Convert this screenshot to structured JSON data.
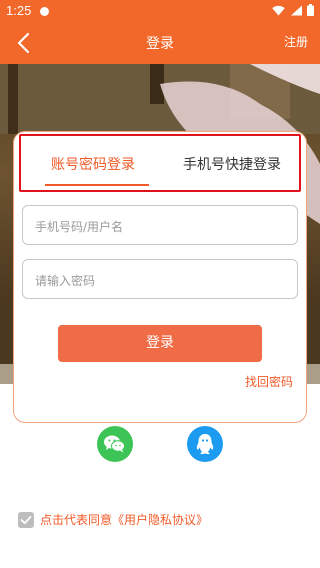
{
  "status_bar": {
    "time": "1:25"
  },
  "app_bar": {
    "title": "登录",
    "register": "注册"
  },
  "tabs": [
    {
      "label": "账号密码登录",
      "active": true
    },
    {
      "label": "手机号快捷登录",
      "active": false
    }
  ],
  "form": {
    "username_placeholder": "手机号码/用户名",
    "password_placeholder": "请输入密码",
    "login_button": "登录",
    "forgot_password": "找回密码"
  },
  "social": {
    "wechat_icon": "wechat-icon",
    "qq_icon": "qq-icon"
  },
  "agreement": {
    "checked": true,
    "text": "点击代表同意《用户隐私协议》"
  },
  "colors": {
    "primary": "#f2682a",
    "accent": "#ef5a27",
    "button": "#ef6c47",
    "highlight_border": "#e0121b",
    "wechat": "#3cc556",
    "qq": "#1d9bf0"
  }
}
